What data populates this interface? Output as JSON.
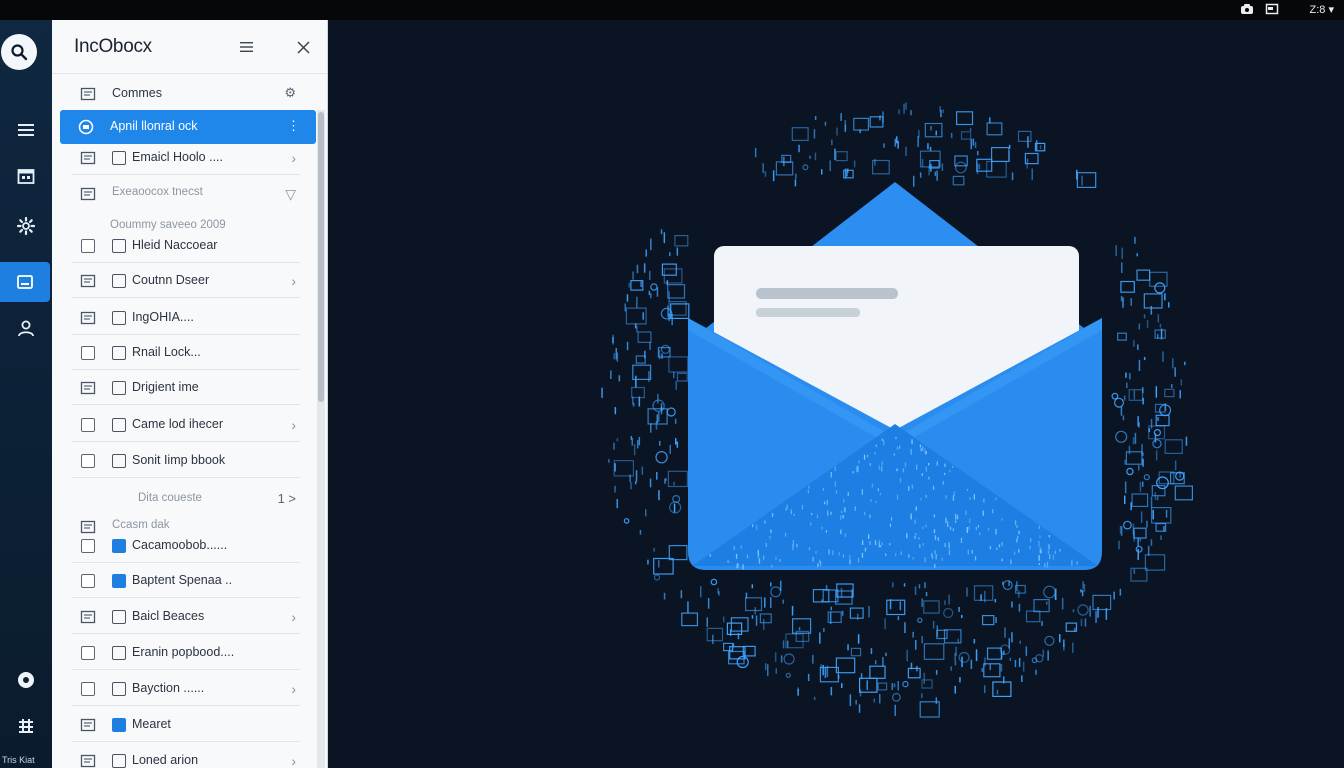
{
  "topbar": {
    "icons": [
      "camera-icon",
      "window-icon"
    ],
    "clock": "Z:8 ▾"
  },
  "rail": {
    "items": [
      {
        "name": "search",
        "icon": "search-icon"
      },
      {
        "name": "menu",
        "icon": "hamburger-icon"
      },
      {
        "name": "calendar",
        "icon": "calendar-icon"
      },
      {
        "name": "settings",
        "icon": "gear-icon"
      },
      {
        "name": "inbox",
        "icon": "inbox-icon",
        "active": true
      },
      {
        "name": "people",
        "icon": "person-icon"
      },
      {
        "name": "status",
        "icon": "circle-icon"
      },
      {
        "name": "apps",
        "icon": "grid-icon"
      }
    ],
    "bottom_label": "Tris Kiat"
  },
  "panel": {
    "title": "IncObocx",
    "rows": [
      {
        "label": "Commes",
        "type": "header",
        "trail": "⚙"
      },
      {
        "label": "Apnil llonral ock",
        "type": "selected",
        "trail": "⋮"
      },
      {
        "label": "Emaicl Hoolo ....",
        "type": "item",
        "chev": "›"
      },
      {
        "label": "Exeaoocox tnecst",
        "type": "section",
        "chev": "▽"
      },
      {
        "label": "Ooummy saveeo 2009",
        "type": "note"
      },
      {
        "label": "Hleid Naccoear",
        "type": "check"
      },
      {
        "label": "Coutnn Dseer",
        "type": "item",
        "chev": "›"
      },
      {
        "label": "IngOHIA....",
        "type": "item"
      },
      {
        "label": "Rnail Lock...",
        "type": "check"
      },
      {
        "label": "Drigient ime",
        "type": "item"
      },
      {
        "label": "Came lod ihecer",
        "type": "check",
        "chev": "›"
      },
      {
        "label": "Sonit Iimp bbook",
        "type": "check"
      },
      {
        "label": "Dita coueste",
        "type": "note",
        "trail": "1 >"
      },
      {
        "label": "Ccasm dak",
        "type": "section"
      },
      {
        "label": "Cacamoobob......",
        "type": "check-blue"
      },
      {
        "label": "Baptent Spenaa ..",
        "type": "check-blue"
      },
      {
        "label": "Baicl Beaces",
        "type": "item",
        "chev": "›"
      },
      {
        "label": "Eranin popbood....",
        "type": "check"
      },
      {
        "label": "Bayction ......",
        "type": "check",
        "chev": "›"
      },
      {
        "label": "Mearet",
        "type": "item-blue"
      },
      {
        "label": "Loned arion",
        "type": "item",
        "chev": "›"
      }
    ]
  },
  "colors": {
    "accent": "#1f86ea",
    "background": "#0a1422",
    "glyph": "#3fa3ff"
  }
}
